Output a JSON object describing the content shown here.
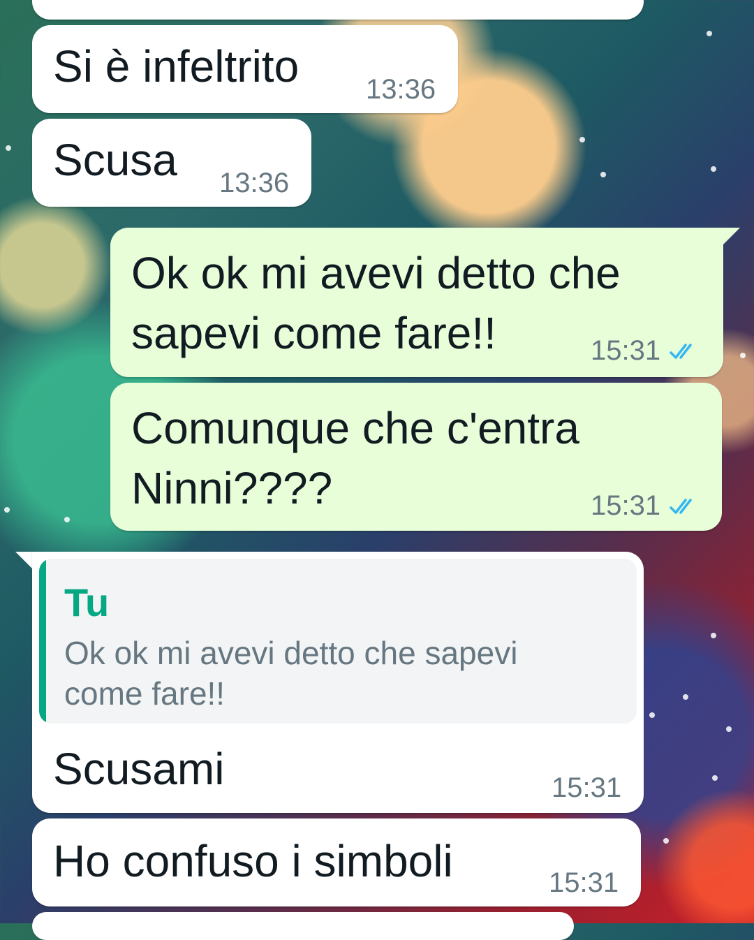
{
  "messages": [
    {
      "text": "Si è infeltrito",
      "time": "13:36"
    },
    {
      "text": "Scusa",
      "time": "13:36"
    },
    {
      "text": "Ok ok mi avevi detto che\nsapevi come fare!!",
      "time": "15:31"
    },
    {
      "text": "Comunque che c'entra\nNinni????",
      "time": "15:31"
    },
    {
      "reply_author": "Tu",
      "reply_text": "Ok ok mi avevi detto che sapevi come fare!!",
      "text": "Scusami",
      "time": "15:31"
    },
    {
      "text": "Ho confuso i simboli",
      "time": "15:31"
    }
  ],
  "colors": {
    "incoming_bubble": "#ffffff",
    "outgoing_bubble": "#e7fed9",
    "read_ticks": "#34b7f1",
    "quote_accent": "#06a884"
  },
  "icons": [
    "double-check-icon"
  ]
}
